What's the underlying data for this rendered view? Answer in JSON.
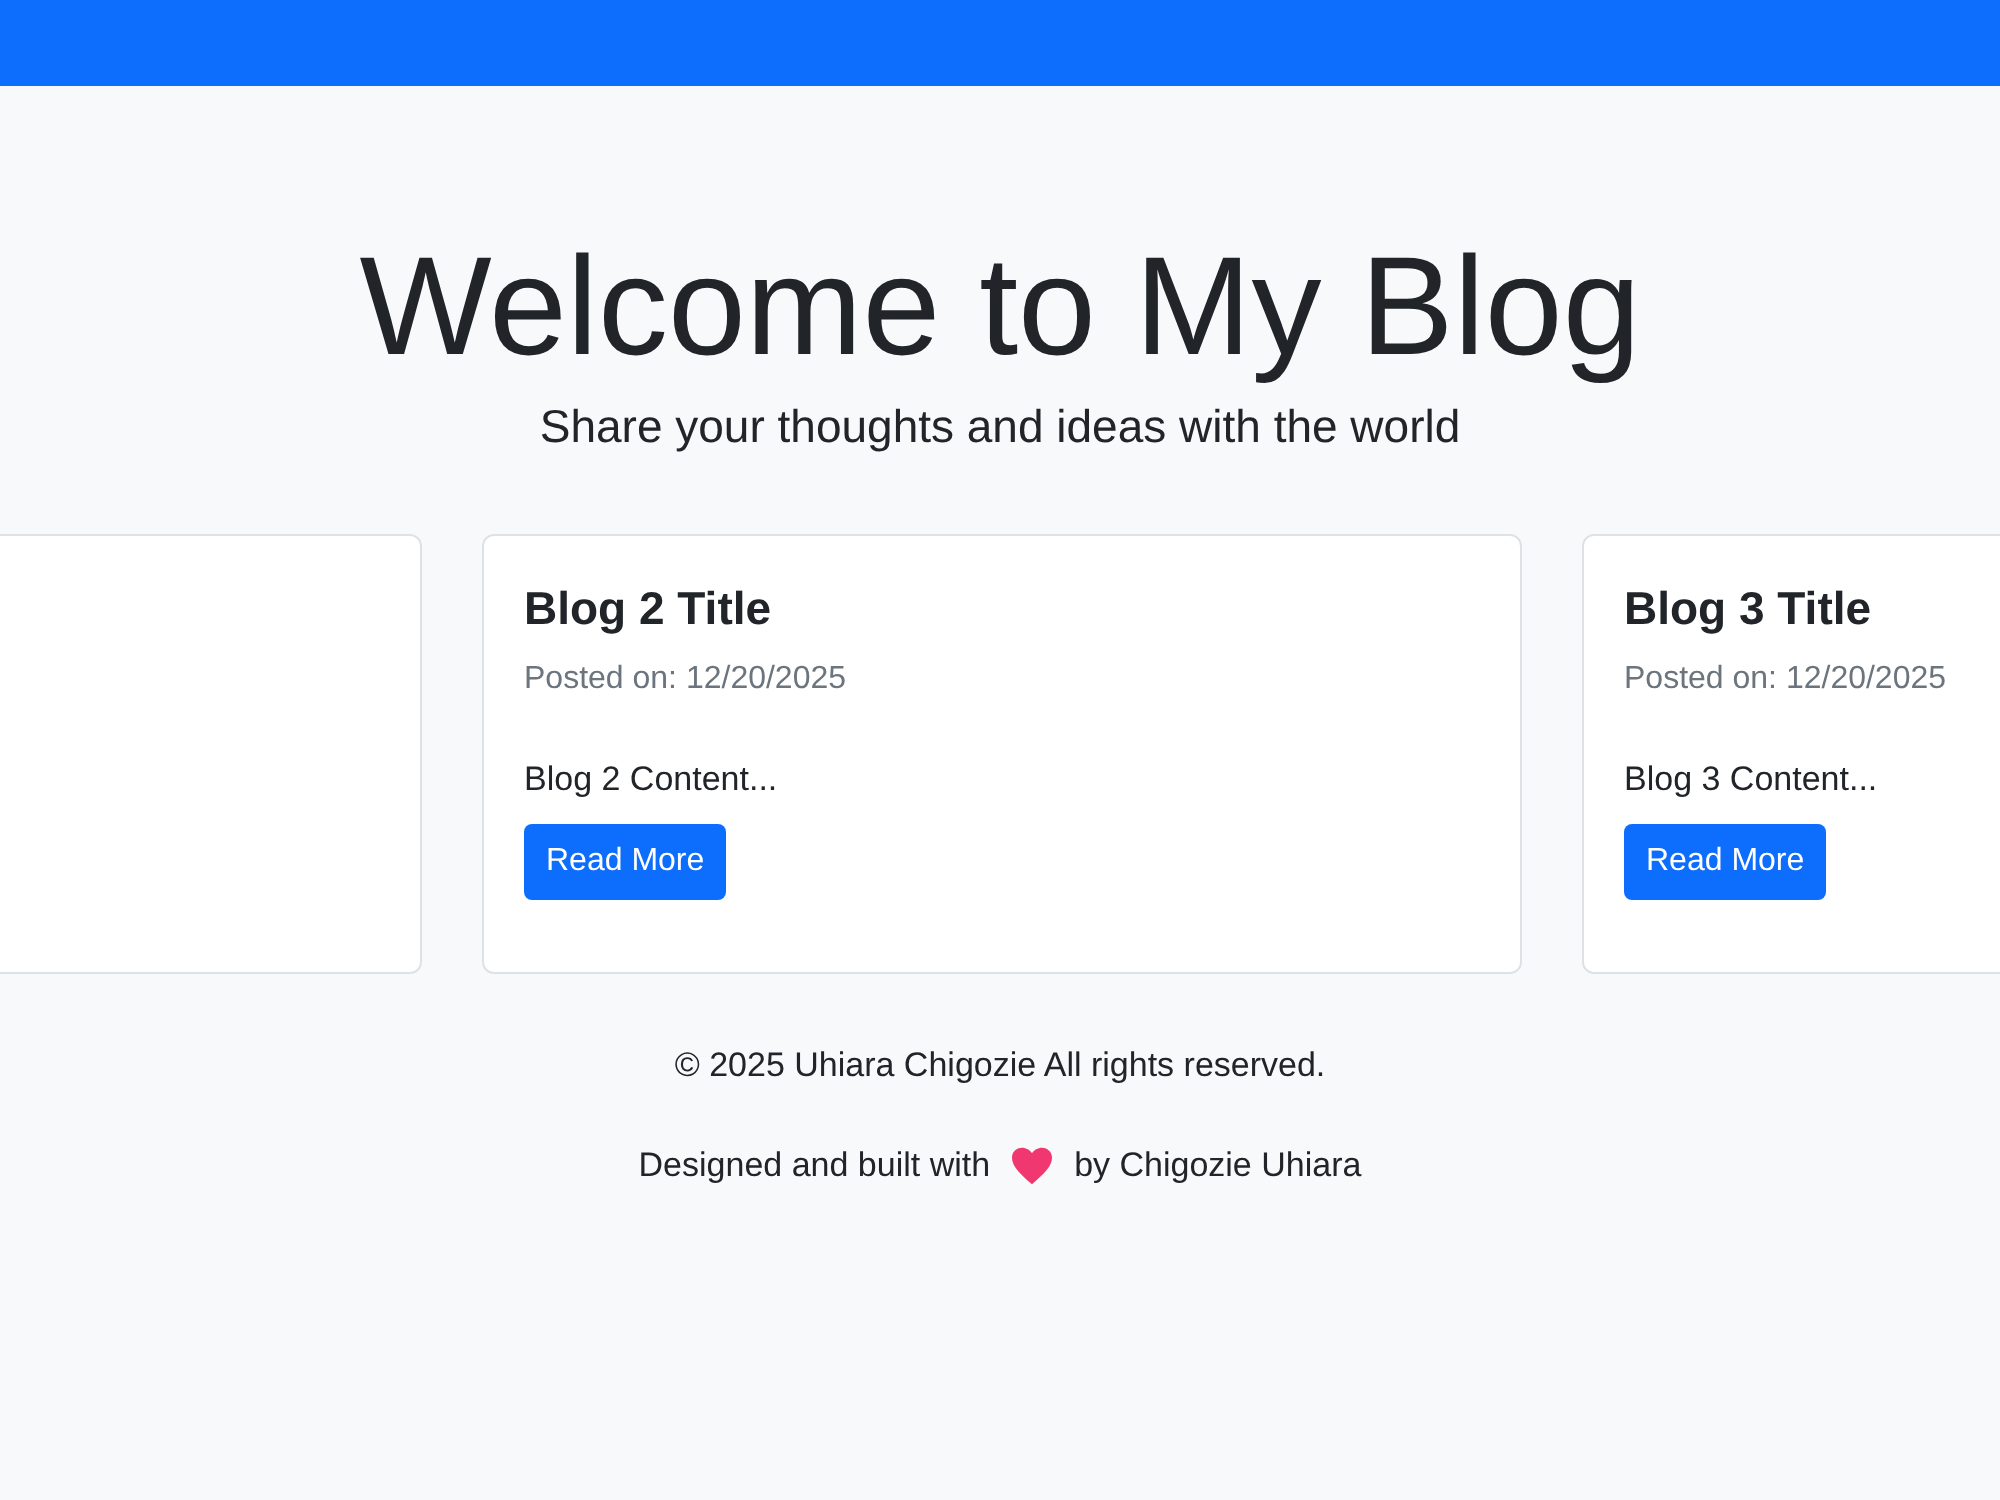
{
  "header": {
    "title": "Welcome to My Blog",
    "subtitle": "Share your thoughts and ideas with the world"
  },
  "posts": [
    {
      "title": "Blog 2 Title",
      "date": "Posted on: 12/20/2025",
      "content": "Blog 2 Content...",
      "button": "Read More"
    },
    {
      "title": "Blog 3 Title",
      "date": "Posted on: 12/20/2025",
      "content": "Blog 3 Content...",
      "button": "Read More"
    }
  ],
  "footer": {
    "copyright": "© 2025 Uhiara Chigozie All rights reserved.",
    "credit_before": "Designed and built with",
    "credit_after": "by Chigozie Uhiara"
  }
}
